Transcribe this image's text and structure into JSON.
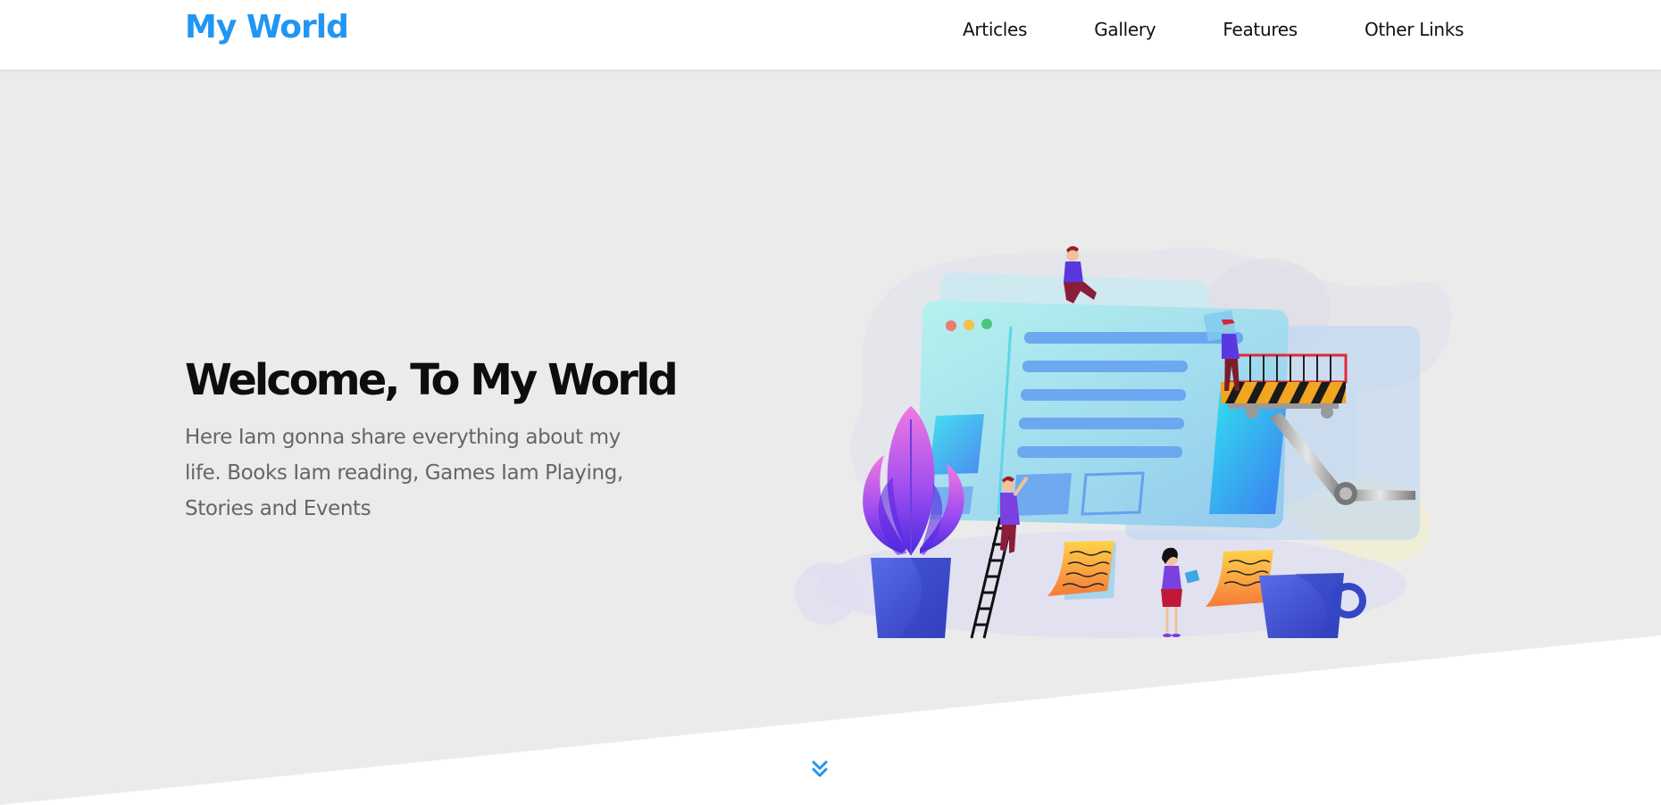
{
  "header": {
    "logo": "My World",
    "nav": [
      {
        "label": "Articles"
      },
      {
        "label": "Gallery"
      },
      {
        "label": "Features"
      },
      {
        "label": "Other Links"
      }
    ]
  },
  "hero": {
    "title": "Welcome, To My World",
    "description": "Here Iam gonna share everything about my life. Books Iam reading, Games Iam Playing, Stories and Events",
    "illustration": "website-building-illustration",
    "scroll_icon": "double-chevron-down-icon"
  },
  "colors": {
    "accent": "#2196f3",
    "hero_background": "#ebebeb",
    "page_background": "#ffffff",
    "heading": "#0d0d0d",
    "body_text": "#666666"
  }
}
